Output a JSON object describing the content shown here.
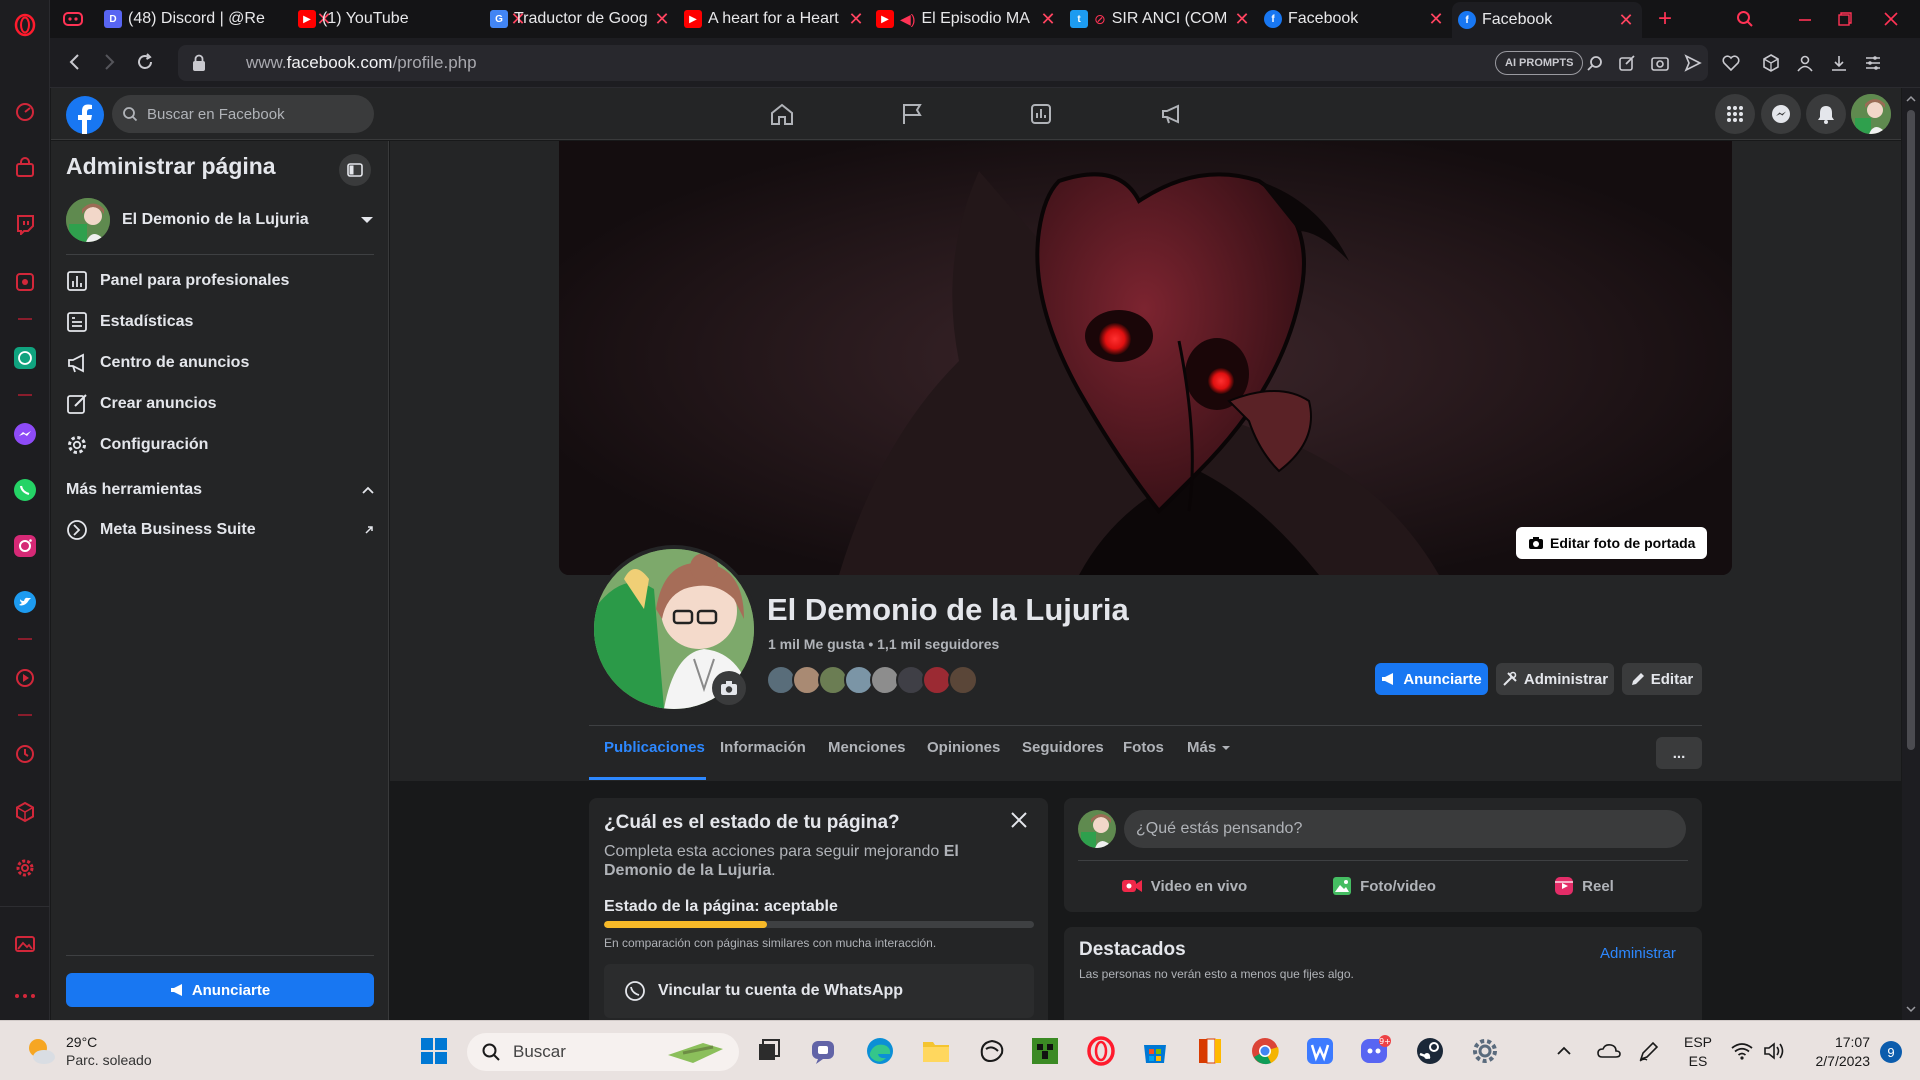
{
  "browser": {
    "tabs": [
      {
        "title": "(48) Discord | @Re",
        "favicon": "discord-icon",
        "color": "#5865f2"
      },
      {
        "title": "(1) YouTube",
        "favicon": "youtube-icon",
        "color": "#ff0000"
      },
      {
        "title": "Traductor de Goog",
        "favicon": "translate-icon",
        "color": "#4285f4"
      },
      {
        "title": "A heart for a Heart",
        "favicon": "youtube-icon",
        "color": "#ff0000"
      },
      {
        "title": "El Episodio MA",
        "favicon": "youtube-icon",
        "color": "#ff0000"
      },
      {
        "title": "SIR ANCI (COM",
        "favicon": "twitter-icon",
        "color": "#1d9bf0"
      },
      {
        "title": "Facebook",
        "favicon": "facebook-icon",
        "color": "#1877f2"
      },
      {
        "title": "Facebook",
        "favicon": "facebook-icon",
        "color": "#1877f2"
      }
    ],
    "url_prefix": "www.",
    "url_domain": "facebook.com",
    "url_path": "/profile.php",
    "ai_prompts_label": "AI PROMPTS"
  },
  "fb": {
    "search_placeholder": "Buscar en Facebook"
  },
  "left_panel": {
    "title": "Administrar página",
    "page_name": "El Demonio de la Lujuria",
    "items": [
      {
        "label": "Panel para profesionales",
        "icon": "dashboard-icon"
      },
      {
        "label": "Estadísticas",
        "icon": "insights-icon"
      },
      {
        "label": "Centro de anuncios",
        "icon": "megaphone-icon"
      },
      {
        "label": "Crear anuncios",
        "icon": "edit-icon"
      },
      {
        "label": "Configuración",
        "icon": "gear-icon"
      }
    ],
    "more_tools": "Más herramientas",
    "meta_business": "Meta Business Suite",
    "advertise_button": "Anunciarte"
  },
  "profile": {
    "edit_cover": "Editar foto de portada",
    "name": "El Demonio de la Lujuria",
    "stats": "1 mil Me gusta • 1,1 mil seguidores",
    "buttons": {
      "advertise": "Anunciarte",
      "manage": "Administrar",
      "edit": "Editar"
    },
    "tabs": [
      "Publicaciones",
      "Información",
      "Menciones",
      "Opiniones",
      "Seguidores",
      "Fotos",
      "Más"
    ],
    "more_options": "..."
  },
  "status_card": {
    "title": "¿Cuál es el estado de tu página?",
    "subtitle_text": "Completa esta acciones para seguir mejorando",
    "subtitle_bold": "El Demonio de la Lujuria",
    "subtitle_end": ".",
    "status_label": "Estado de la página: aceptable",
    "progress": 0.38,
    "comparison": "En comparación con páginas similares con mucha interacción.",
    "whatsapp": "Vincular tu cuenta de WhatsApp"
  },
  "composer": {
    "placeholder": "¿Qué estás pensando?",
    "live": "Video en vivo",
    "photo": "Foto/video",
    "reel": "Reel"
  },
  "featured": {
    "title": "Destacados",
    "subtitle": "Las personas no verán esto a menos que fijes algo.",
    "manage": "Administrar"
  },
  "taskbar": {
    "temp": "29°C",
    "weather": "Parc. soleado",
    "search": "Buscar",
    "lang1": "ESP",
    "lang2": "ES",
    "time": "17:07",
    "date": "2/7/2023",
    "notif_count": "9"
  },
  "colors": {
    "fb_blue": "#1877f2",
    "opera_red": "#ff1b2d",
    "progress": "#f7b928"
  }
}
